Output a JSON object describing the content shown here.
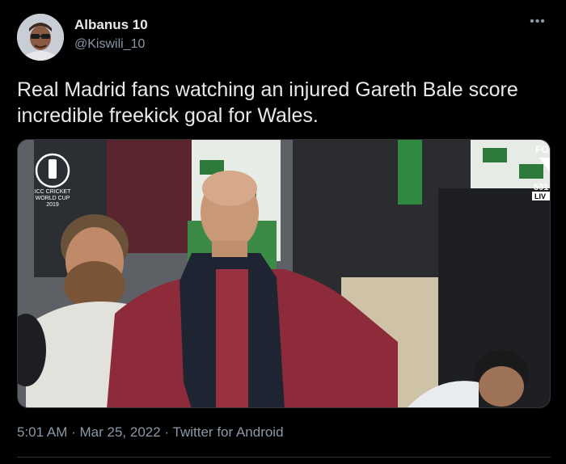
{
  "author": {
    "display_name": "Albanus 10",
    "handle": "@Kiswili_10"
  },
  "more_label": "•••",
  "tweet_text": "Real Madrid fans watching an injured Gareth Bale score incredible freekick goal for Wales.",
  "media": {
    "overlay_logo_lines": [
      "ICC CRICKET",
      "WORLD CUP",
      "2019"
    ],
    "overlay_score": "501",
    "overlay_live": "LIV",
    "overlay_top": "FO"
  },
  "meta": {
    "time": "5:01 AM",
    "separator": "·",
    "date": "Mar 25, 2022",
    "client": "Twitter for Android"
  },
  "colors": {
    "background": "#000000",
    "text_primary": "#e7e9ea",
    "text_secondary": "#8b98a5",
    "border": "#2f3336"
  }
}
